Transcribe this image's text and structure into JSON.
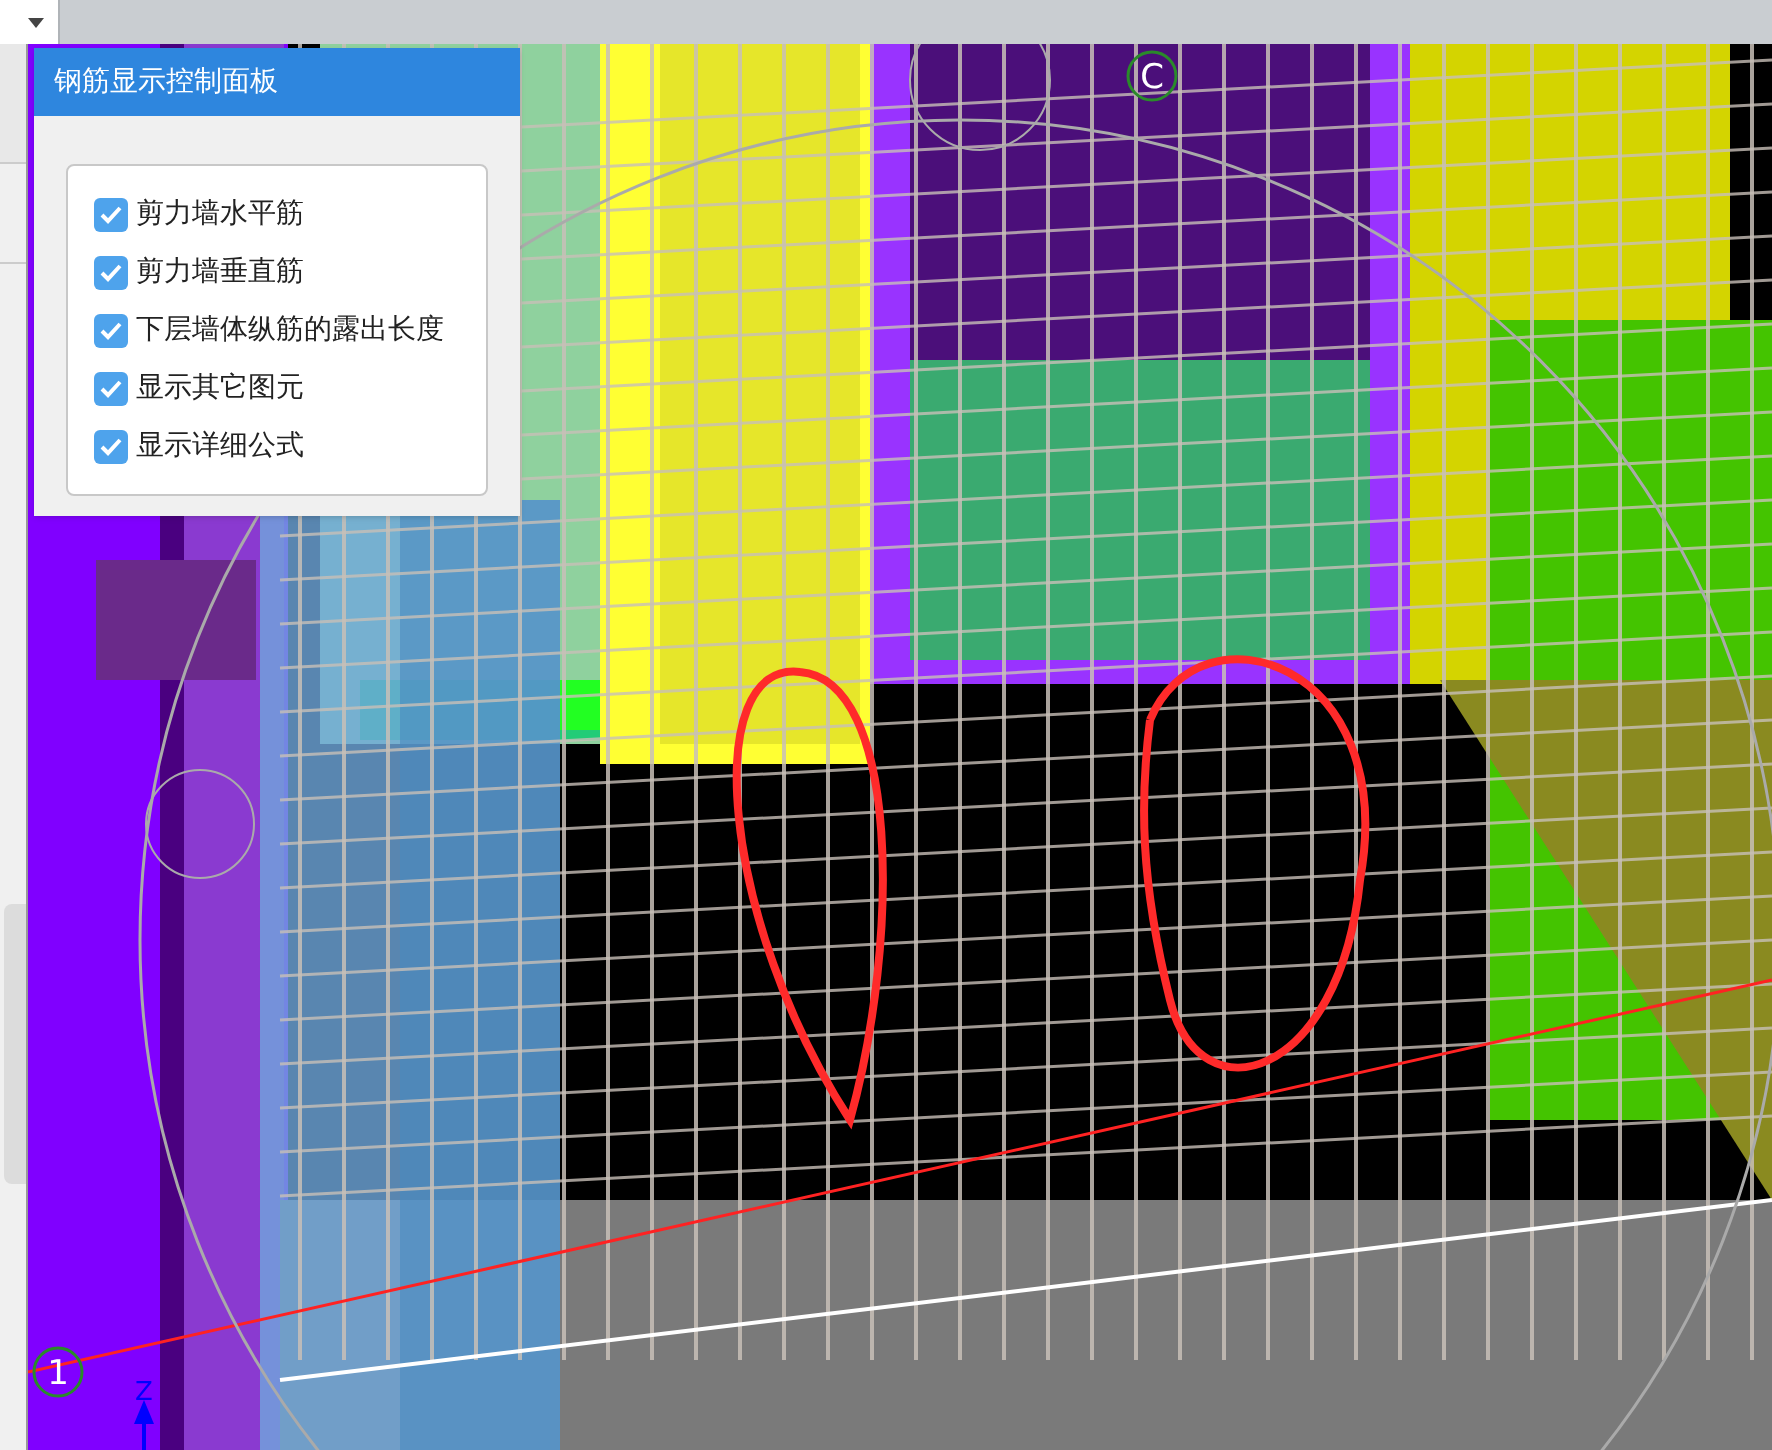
{
  "rebar_panel": {
    "title": "钢筋显示控制面板",
    "options": [
      {
        "label": "剪力墙水平筋",
        "checked": true
      },
      {
        "label": "剪力墙垂直筋",
        "checked": true
      },
      {
        "label": "下层墙体纵筋的露出长度",
        "checked": true
      },
      {
        "label": "显示其它图元",
        "checked": true
      },
      {
        "label": "显示详细公式",
        "checked": true
      }
    ]
  },
  "viewport": {
    "grid_axis_labels": [
      {
        "text": "C",
        "kind": "top"
      },
      {
        "text": "1",
        "kind": "left"
      }
    ],
    "axis_label": "Z"
  }
}
